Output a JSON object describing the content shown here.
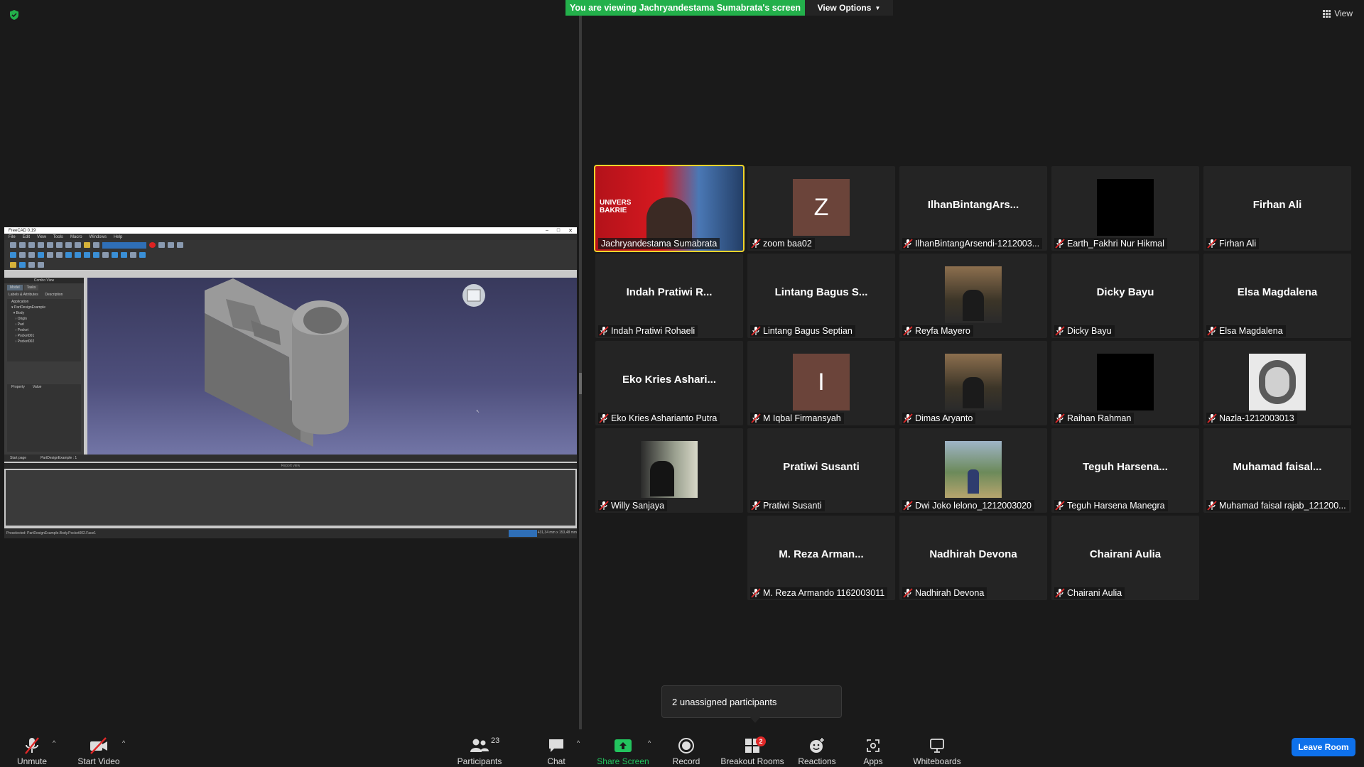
{
  "top": {
    "banner_text": "You are viewing Jachryandestama Sumabrata's screen",
    "view_options": "View Options",
    "view_label": "View"
  },
  "gallery": [
    {
      "big": "",
      "name": "Jachryandestama Sumabrata",
      "kind": "video",
      "active": true,
      "muted": false
    },
    {
      "big": "Z",
      "name": "zoom baa02",
      "kind": "letter",
      "muted": true
    },
    {
      "big": "IlhanBintangArs...",
      "name": "IlhanBintangArsendi-1212003...",
      "kind": "text",
      "muted": true
    },
    {
      "big": "",
      "name": "Earth_Fakhri Nur Hikmal",
      "kind": "black",
      "muted": true
    },
    {
      "big": "Firhan Ali",
      "name": "Firhan Ali",
      "kind": "text",
      "muted": true
    },
    {
      "big": "Indah Pratiwi R...",
      "name": "Indah Pratiwi Rohaeli",
      "kind": "text",
      "muted": true
    },
    {
      "big": "Lintang Bagus S...",
      "name": "Lintang Bagus Septian",
      "kind": "text",
      "muted": true
    },
    {
      "big": "",
      "name": "Reyfa Mayero",
      "kind": "photo",
      "muted": true
    },
    {
      "big": "Dicky Bayu",
      "name": "Dicky Bayu",
      "kind": "text",
      "muted": true
    },
    {
      "big": "Elsa Magdalena",
      "name": "Elsa Magdalena",
      "kind": "text",
      "muted": true
    },
    {
      "big": "Eko Kries Ashari...",
      "name": "Eko Kries Asharianto Putra",
      "kind": "text",
      "muted": true
    },
    {
      "big": "I",
      "name": "M Iqbal Firmansyah",
      "kind": "letter",
      "muted": true
    },
    {
      "big": "",
      "name": "Dimas Aryanto",
      "kind": "photo",
      "muted": true
    },
    {
      "big": "",
      "name": "Raihan Rahman",
      "kind": "black",
      "muted": true
    },
    {
      "big": "",
      "name": "Nazla-1212003013",
      "kind": "cartoon",
      "muted": true
    },
    {
      "big": "",
      "name": "Willy Sanjaya",
      "kind": "photo-dark",
      "muted": true
    },
    {
      "big": "Pratiwi Susanti",
      "name": "Pratiwi Susanti",
      "kind": "text",
      "muted": true
    },
    {
      "big": "",
      "name": "Dwi Joko lelono_1212003020",
      "kind": "photo-outdoor",
      "muted": true
    },
    {
      "big": "Teguh Harsena...",
      "name": "Teguh Harsena Manegra",
      "kind": "text",
      "muted": true
    },
    {
      "big": "Muhamad faisal...",
      "name": "Muhamad faisal rajab_121200...",
      "kind": "text",
      "muted": true
    },
    {
      "big": "M. Reza Arman...",
      "name": "M. Reza Armando 1162003011",
      "kind": "text",
      "muted": true
    },
    {
      "big": "Nadhirah Devona",
      "name": "Nadhirah Devona",
      "kind": "text",
      "muted": true
    },
    {
      "big": "Chairani Aulia",
      "name": "Chairani Aulia",
      "kind": "text",
      "muted": true
    }
  ],
  "tooltip": "2 unassigned participants",
  "toolbar": {
    "unmute": "Unmute",
    "start_video": "Start Video",
    "participants": "Participants",
    "participants_count": "23",
    "chat": "Chat",
    "share_screen": "Share Screen",
    "record": "Record",
    "breakout_rooms": "Breakout Rooms",
    "breakout_badge": "2",
    "reactions": "Reactions",
    "apps": "Apps",
    "whiteboards": "Whiteboards",
    "leave": "Leave Room"
  },
  "colors": {
    "banner": "#23b04b",
    "active_speaker": "#f1d42b",
    "leave": "#0e71eb",
    "share_green": "#23c45e",
    "badge": "#e02828"
  }
}
